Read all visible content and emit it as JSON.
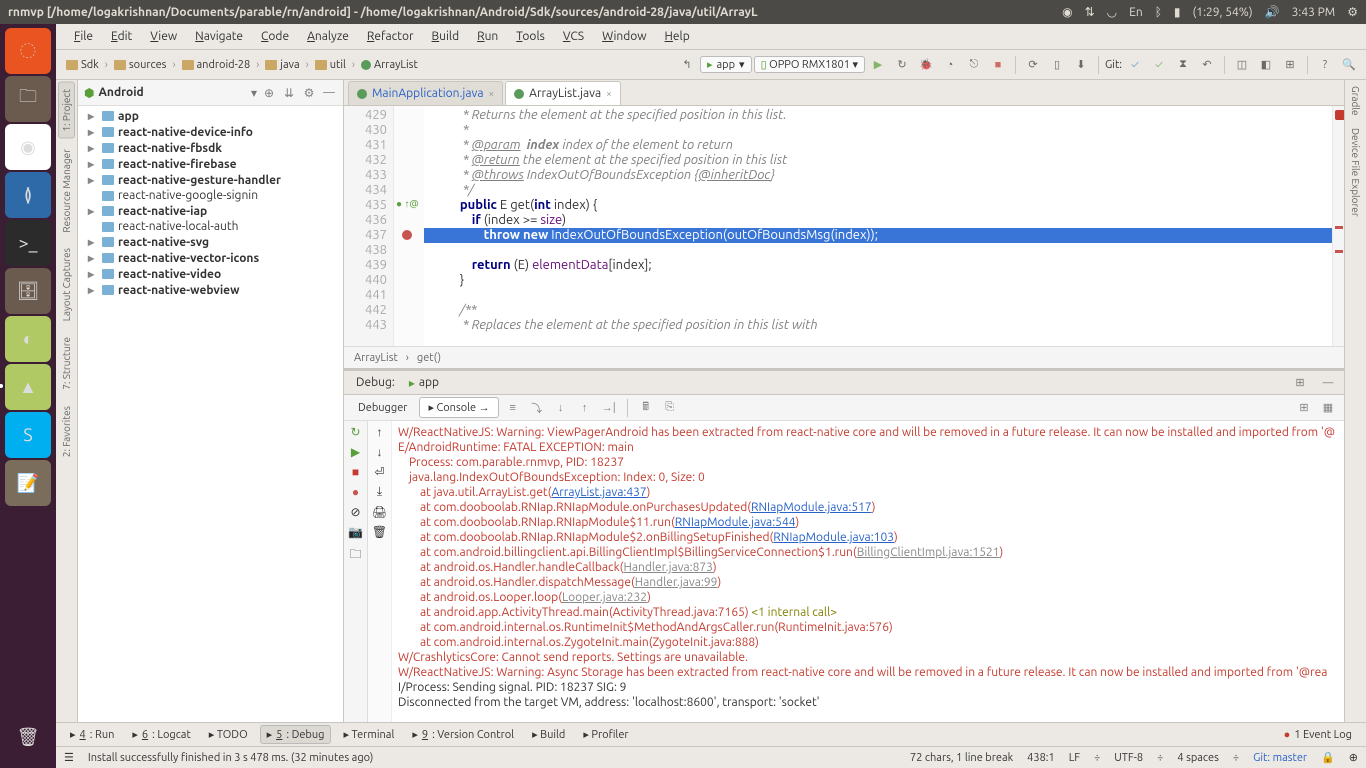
{
  "ubuntu": {
    "title": "rnmvp [/home/logakrishnan/Documents/parable/rn/android] - /home/logakrishnan/Android/Sdk/sources/android-28/java/util/ArrayL",
    "lang": "En",
    "battery": "(1:29, 54%)",
    "time": "3:43 PM"
  },
  "menu": [
    "File",
    "Edit",
    "View",
    "Navigate",
    "Code",
    "Analyze",
    "Refactor",
    "Build",
    "Run",
    "Tools",
    "VCS",
    "Window",
    "Help"
  ],
  "breadcrumbs": [
    "Sdk",
    "sources",
    "android-28",
    "java",
    "util",
    "ArrayList"
  ],
  "run_config": "app",
  "device": "OPPO RMX1801",
  "git_label": "Git:",
  "project": {
    "label": "Android",
    "tree": [
      {
        "lbl": "app",
        "bold": true,
        "exp": "▸"
      },
      {
        "lbl": "react-native-device-info",
        "bold": true,
        "exp": "▸"
      },
      {
        "lbl": "react-native-fbsdk",
        "bold": true,
        "exp": "▸"
      },
      {
        "lbl": "react-native-firebase",
        "bold": true,
        "exp": "▸"
      },
      {
        "lbl": "react-native-gesture-handler",
        "bold": true,
        "exp": "▸"
      },
      {
        "lbl": "react-native-google-signin",
        "bold": false,
        "exp": ""
      },
      {
        "lbl": "react-native-iap",
        "bold": true,
        "exp": "▸"
      },
      {
        "lbl": "react-native-local-auth",
        "bold": false,
        "exp": ""
      },
      {
        "lbl": "react-native-svg",
        "bold": true,
        "exp": "▸"
      },
      {
        "lbl": "react-native-vector-icons",
        "bold": true,
        "exp": "▸"
      },
      {
        "lbl": "react-native-video",
        "bold": true,
        "exp": "▸"
      },
      {
        "lbl": "react-native-webview",
        "bold": true,
        "exp": "▸"
      }
    ]
  },
  "tabs": [
    {
      "name": "MainApplication.java",
      "active": false,
      "color": "#2862c7"
    },
    {
      "name": "ArrayList.java",
      "active": true,
      "color": "#333"
    }
  ],
  "code": {
    "start": 429,
    "lines": [
      {
        "n": 429,
        "html": "         <span class='cm'>* Returns the element at the specified position in this list.</span>"
      },
      {
        "n": 430,
        "html": "         <span class='cm'>*</span>"
      },
      {
        "n": 431,
        "html": "         <span class='cm'>* <span class='tag'>@param</span>  <b>index</b> index of the element to return</span>"
      },
      {
        "n": 432,
        "html": "         <span class='cm'>* <span class='tag'>@return</span> the element at the specified position in this list</span>"
      },
      {
        "n": 433,
        "html": "         <span class='cm'>* <span class='tag'>@throws</span> IndexOutOfBoundsException {<span class='tag'>@inheritDoc</span>}</span>"
      },
      {
        "n": 434,
        "html": "         <span class='cm'>*/</span>"
      },
      {
        "n": 435,
        "html": "        <span class='kw'>public</span> E get(<span class='kw'>int</span> index) {"
      },
      {
        "n": 436,
        "html": "            <span class='kw'>if</span> (index &gt;= <span class='ide-br'>size</span>)"
      },
      {
        "n": 437,
        "hl": true,
        "html": "                <span class='kw'>throw new</span> IndexOutOfBoundsException(outOfBoundsMsg(index));"
      },
      {
        "n": 438,
        "html": ""
      },
      {
        "n": 439,
        "html": "            <span class='kw'>return</span> (E) <span class='ide-br'>elementData</span>[index];"
      },
      {
        "n": 440,
        "html": "        }"
      },
      {
        "n": 441,
        "html": ""
      },
      {
        "n": 442,
        "html": "        <span class='cm'>/**</span>"
      },
      {
        "n": 443,
        "html": "         <span class='cm'>* Replaces the element at the specified position in this list with</span>"
      }
    ],
    "crumb": [
      "ArrayList",
      "get()"
    ]
  },
  "debug": {
    "title": "Debug:",
    "config": "app",
    "tabs": [
      "Debugger",
      "Console"
    ],
    "active_tab": "Console",
    "console": [
      {
        "t": "err",
        "txt": "W/ReactNativeJS: Warning: ViewPagerAndroid has been extracted from react-native core and will be removed in a future release. It can now be installed and imported from '@"
      },
      {
        "t": "err",
        "txt": "E/AndroidRuntime: FATAL EXCEPTION: main"
      },
      {
        "t": "err",
        "txt": "    Process: com.parable.rnmvp, PID: 18237"
      },
      {
        "t": "err",
        "txt": "    java.lang.IndexOutOfBoundsException: Index: 0, Size: 0"
      },
      {
        "t": "stk",
        "txt": "        at java.util.ArrayList.get(",
        "link": "ArrayList.java:437",
        "tail": ")"
      },
      {
        "t": "stk",
        "txt": "        at com.dooboolab.RNIap.RNIapModule.onPurchasesUpdated(",
        "link": "RNIapModule.java:517",
        "tail": ")"
      },
      {
        "t": "stk",
        "txt": "        at com.dooboolab.RNIap.RNIapModule$11.run(",
        "link": "RNIapModule.java:544",
        "tail": ")"
      },
      {
        "t": "stk",
        "txt": "        at com.dooboolab.RNIap.RNIapModule$2.onBillingSetupFinished(",
        "link": "RNIapModule.java:103",
        "tail": ")"
      },
      {
        "t": "sdm",
        "txt": "        at com.android.billingclient.api.BillingClientImpl$BillingServiceConnection$1.run(",
        "dim": "BillingClientImpl.java:1521",
        "tail": ")"
      },
      {
        "t": "sdm",
        "txt": "        at android.os.Handler.handleCallback(",
        "dim": "Handler.java:873",
        "tail": ")"
      },
      {
        "t": "sdm",
        "txt": "        at android.os.Handler.dispatchMessage(",
        "dim": "Handler.java:99",
        "tail": ")"
      },
      {
        "t": "sdm",
        "txt": "        at android.os.Looper.loop(",
        "dim": "Looper.java:232",
        "tail": ")"
      },
      {
        "t": "int",
        "txt": "        at android.app.ActivityThread.main(ActivityThread.java:7165) ",
        "intcall": "<1 internal call>"
      },
      {
        "t": "err",
        "txt": "        at com.android.internal.os.RuntimeInit$MethodAndArgsCaller.run(RuntimeInit.java:576)"
      },
      {
        "t": "err",
        "txt": "        at com.android.internal.os.ZygoteInit.main(ZygoteInit.java:888)"
      },
      {
        "t": "err",
        "txt": "W/CrashlyticsCore: Cannot send reports. Settings are unavailable."
      },
      {
        "t": "err",
        "txt": "W/ReactNativeJS: Warning: Async Storage has been extracted from react-native core and will be removed in a future release. It can now be installed and imported from '@rea"
      },
      {
        "t": "plain",
        "txt": "I/Process: Sending signal. PID: 18237 SIG: 9"
      },
      {
        "t": "plain",
        "txt": "Disconnected from the target VM, address: 'localhost:8600', transport: 'socket'"
      }
    ]
  },
  "bottom": [
    {
      "lbl": "4: Run",
      "u": "4"
    },
    {
      "lbl": "6: Logcat",
      "u": "6"
    },
    {
      "lbl": "TODO",
      "u": ""
    },
    {
      "lbl": "5: Debug",
      "u": "5",
      "active": true
    },
    {
      "lbl": "Terminal",
      "u": ""
    },
    {
      "lbl": "9: Version Control",
      "u": "9"
    },
    {
      "lbl": "Build",
      "u": ""
    },
    {
      "lbl": "Profiler",
      "u": ""
    }
  ],
  "event_log": "1 Event Log",
  "status": {
    "msg": "Install successfully finished in 3 s 478 ms. (32 minutes ago)",
    "chars": "72 chars, 1 line break",
    "pos": "438:1",
    "le": "LF",
    "enc": "UTF-8",
    "indent": "4 spaces",
    "git": "Git: master"
  },
  "left_tabs": [
    "1: Project",
    "Resource Manager",
    "Layout Captures",
    "7: Structure",
    "2: Favorites"
  ],
  "right_tabs": [
    "Gradle",
    "Device File Explorer"
  ]
}
